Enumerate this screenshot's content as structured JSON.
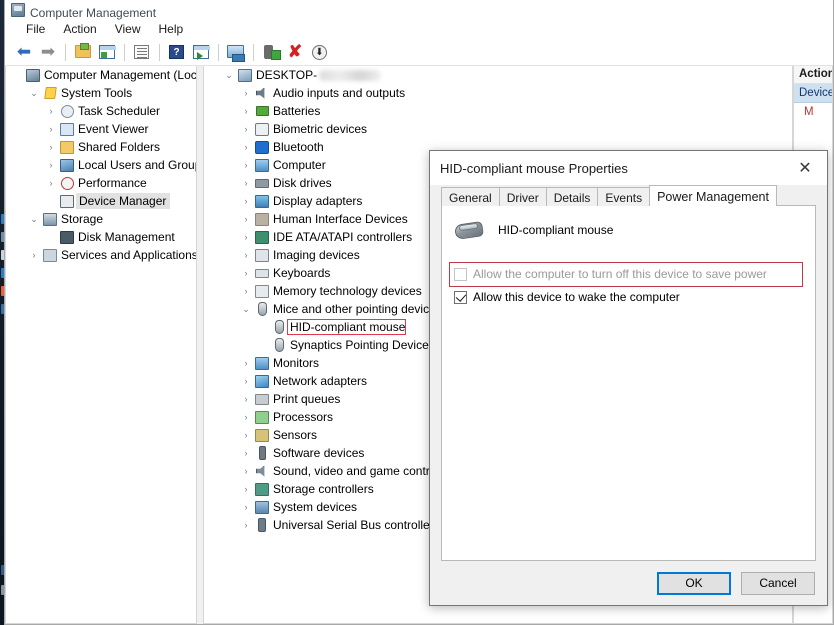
{
  "window": {
    "title": "Computer Management",
    "icon": "computer-management-icon"
  },
  "menu": [
    {
      "label": "File"
    },
    {
      "label": "Action"
    },
    {
      "label": "View"
    },
    {
      "label": "Help"
    }
  ],
  "toolbar": [
    {
      "name": "back-icon",
      "glyph": "←"
    },
    {
      "name": "forward-icon",
      "glyph": "→"
    },
    {
      "name": "up-one-level-icon",
      "glyph": ""
    },
    {
      "name": "show-hide-console-tree-icon",
      "glyph": ""
    },
    {
      "name": "properties-icon",
      "glyph": ""
    },
    {
      "name": "help-icon",
      "glyph": "?"
    },
    {
      "name": "show-hide-action-pane-icon",
      "glyph": ""
    },
    {
      "name": "scan-for-hardware-changes-icon",
      "glyph": ""
    },
    {
      "name": "add-legacy-hardware-icon",
      "glyph": ""
    },
    {
      "name": "uninstall-device-icon",
      "glyph": "✕"
    },
    {
      "name": "update-driver-icon",
      "glyph": "↓"
    }
  ],
  "console_tree": {
    "items": [
      {
        "label": "Computer Management (Local",
        "depth": 0,
        "twisty": "",
        "icon": "i-cm",
        "selected": false
      },
      {
        "label": "System Tools",
        "depth": 1,
        "twisty": "v",
        "icon": "i-tools",
        "selected": false
      },
      {
        "label": "Task Scheduler",
        "depth": 2,
        "twisty": ">",
        "icon": "i-clock",
        "selected": false
      },
      {
        "label": "Event Viewer",
        "depth": 2,
        "twisty": ">",
        "icon": "i-event",
        "selected": false
      },
      {
        "label": "Shared Folders",
        "depth": 2,
        "twisty": ">",
        "icon": "i-shared",
        "selected": false
      },
      {
        "label": "Local Users and Groups",
        "depth": 2,
        "twisty": ">",
        "icon": "i-users",
        "selected": false
      },
      {
        "label": "Performance",
        "depth": 2,
        "twisty": ">",
        "icon": "i-perf",
        "selected": false
      },
      {
        "label": "Device Manager",
        "depth": 2,
        "twisty": "",
        "icon": "i-dm",
        "selected": true
      },
      {
        "label": "Storage",
        "depth": 1,
        "twisty": "v",
        "icon": "i-stor",
        "selected": false
      },
      {
        "label": "Disk Management",
        "depth": 2,
        "twisty": "",
        "icon": "i-disk",
        "selected": false
      },
      {
        "label": "Services and Applications",
        "depth": 1,
        "twisty": ">",
        "icon": "i-serv",
        "selected": false
      }
    ]
  },
  "device_tree": {
    "root": {
      "label": "DESKTOP-",
      "redacted": true,
      "twisty": "v",
      "icon": "i-pc"
    },
    "items": [
      {
        "label": "Audio inputs and outputs",
        "depth": 1,
        "twisty": ">",
        "icon": "i-audio",
        "highlight": false
      },
      {
        "label": "Batteries",
        "depth": 1,
        "twisty": ">",
        "icon": "i-batt",
        "highlight": false
      },
      {
        "label": "Biometric devices",
        "depth": 1,
        "twisty": ">",
        "icon": "i-bio",
        "highlight": false
      },
      {
        "label": "Bluetooth",
        "depth": 1,
        "twisty": ">",
        "icon": "i-bt",
        "highlight": false
      },
      {
        "label": "Computer",
        "depth": 1,
        "twisty": ">",
        "icon": "i-mon",
        "highlight": false
      },
      {
        "label": "Disk drives",
        "depth": 1,
        "twisty": ">",
        "icon": "i-drive",
        "highlight": false
      },
      {
        "label": "Display adapters",
        "depth": 1,
        "twisty": ">",
        "icon": "i-displ",
        "highlight": false
      },
      {
        "label": "Human Interface Devices",
        "depth": 1,
        "twisty": ">",
        "icon": "i-hid",
        "highlight": false
      },
      {
        "label": "IDE ATA/ATAPI controllers",
        "depth": 1,
        "twisty": ">",
        "icon": "i-ide",
        "highlight": false
      },
      {
        "label": "Imaging devices",
        "depth": 1,
        "twisty": ">",
        "icon": "i-imag",
        "highlight": false
      },
      {
        "label": "Keyboards",
        "depth": 1,
        "twisty": ">",
        "icon": "i-kbd",
        "highlight": false
      },
      {
        "label": "Memory technology devices",
        "depth": 1,
        "twisty": ">",
        "icon": "i-mem",
        "highlight": false
      },
      {
        "label": "Mice and other pointing devices",
        "depth": 1,
        "twisty": "v",
        "icon": "i-mouse",
        "highlight": false
      },
      {
        "label": "HID-compliant mouse",
        "depth": 2,
        "twisty": "",
        "icon": "i-mouse",
        "highlight": true
      },
      {
        "label": "Synaptics Pointing Device",
        "depth": 2,
        "twisty": "",
        "icon": "i-mouse",
        "highlight": false
      },
      {
        "label": "Monitors",
        "depth": 1,
        "twisty": ">",
        "icon": "i-mon",
        "highlight": false
      },
      {
        "label": "Network adapters",
        "depth": 1,
        "twisty": ">",
        "icon": "i-net",
        "highlight": false
      },
      {
        "label": "Print queues",
        "depth": 1,
        "twisty": ">",
        "icon": "i-print",
        "highlight": false
      },
      {
        "label": "Processors",
        "depth": 1,
        "twisty": ">",
        "icon": "i-cpu",
        "highlight": false
      },
      {
        "label": "Sensors",
        "depth": 1,
        "twisty": ">",
        "icon": "i-sens",
        "highlight": false
      },
      {
        "label": "Software devices",
        "depth": 1,
        "twisty": ">",
        "icon": "i-soft",
        "highlight": false
      },
      {
        "label": "Sound, video and game controllers",
        "depth": 1,
        "twisty": ">",
        "icon": "i-snd",
        "highlight": false
      },
      {
        "label": "Storage controllers",
        "depth": 1,
        "twisty": ">",
        "icon": "i-stc",
        "highlight": false
      },
      {
        "label": "System devices",
        "depth": 1,
        "twisty": ">",
        "icon": "i-sysd",
        "highlight": false
      },
      {
        "label": "Universal Serial Bus controllers",
        "depth": 1,
        "twisty": ">",
        "icon": "i-usb",
        "highlight": false
      }
    ]
  },
  "actions_pane": {
    "header": "Actions",
    "subheader": "Device Manager",
    "item": "M"
  },
  "dialog": {
    "title": "HID-compliant mouse Properties",
    "close_glyph": "✕",
    "tabs": [
      {
        "label": "General",
        "active": false
      },
      {
        "label": "Driver",
        "active": false
      },
      {
        "label": "Details",
        "active": false
      },
      {
        "label": "Events",
        "active": false
      },
      {
        "label": "Power Management",
        "active": true
      }
    ],
    "device_name": "HID-compliant mouse",
    "checkboxes": [
      {
        "label": "Allow the computer to turn off this device to save power",
        "checked": false,
        "disabled": true,
        "highlighted": true
      },
      {
        "label": "Allow this device to wake the computer",
        "checked": true,
        "disabled": false,
        "highlighted": false
      }
    ],
    "buttons": [
      {
        "label": "OK",
        "default": true
      },
      {
        "label": "Cancel",
        "default": false
      }
    ]
  },
  "colors": {
    "accent": "#0078d7",
    "highlight_red": "#e03a4e",
    "selection_gray": "#e2e2e2",
    "actions_blue": "#cfe0f0"
  }
}
